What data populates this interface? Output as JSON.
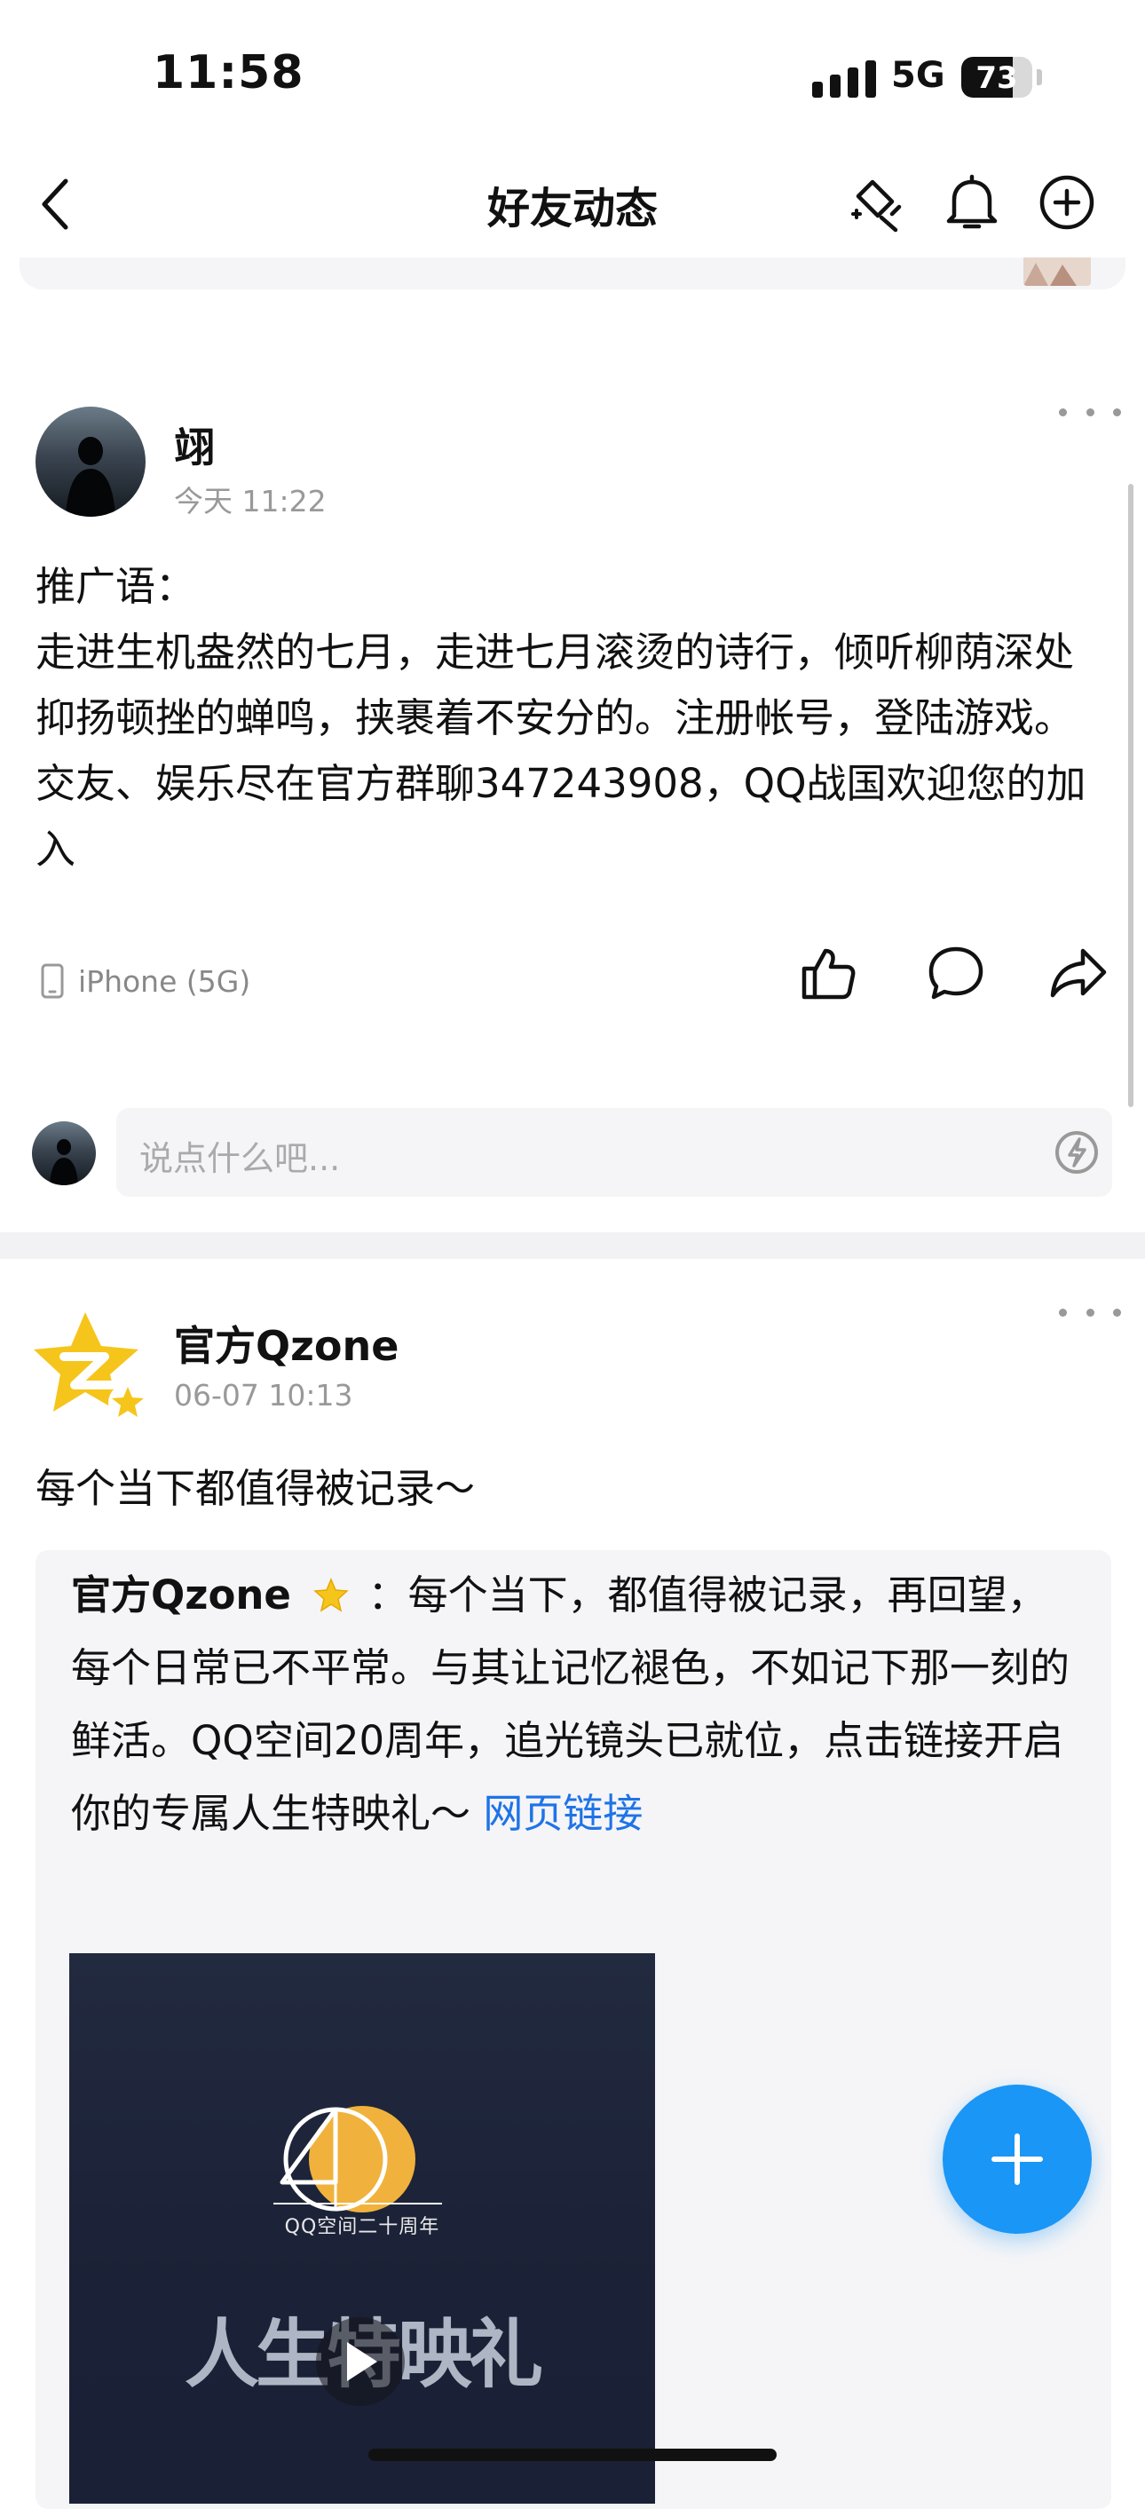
{
  "status_bar": {
    "time": "11:58",
    "network": "5G",
    "battery": "73",
    "battery_level": 0.73
  },
  "nav": {
    "title": "好友动态"
  },
  "posts": [
    {
      "author": "翊",
      "time": "今天 11:22",
      "text": "推广语：\n走进生机盎然的七月，走进七月滚烫的诗行，倾听柳荫深处抑扬顿挫的蝉鸣，挟裹着不安分的。注册帐号，登陆游戏。交友、娱乐尽在官方群聊347243908，QQ战国欢迎您的加入",
      "device": "iPhone (5G)"
    },
    {
      "author": "官方Qzone",
      "time": "06-07 10:13",
      "text": "每个当下都值得被记录～",
      "repost": {
        "author": "官方Qzone",
        "separator": "：",
        "text": "每个当下，都值得被记录，再回望，每个日常已不平常。与其让记忆褪色，不如记下那一刻的鲜活。QQ空间20周年，追光镜头已就位，点击链接开启你的专属人生特映礼～",
        "link": "网页链接",
        "video": {
          "badge_text": "QQ空间二十周年",
          "title": "人生特映礼"
        }
      }
    }
  ],
  "comment": {
    "placeholder": "说点什么吧..."
  },
  "icons": {
    "back": "back-icon",
    "edit": "edit-sparkle-icon",
    "bell": "bell-icon",
    "add": "add-circle-icon",
    "like": "thumbs-up-icon",
    "comment": "comment-bubble-icon",
    "share": "share-arrow-icon",
    "emoji": "emoji-lightning-icon",
    "phone": "phone-icon",
    "play": "play-icon",
    "verified": "star-badge-icon"
  },
  "colors": {
    "accent": "#1a96f6",
    "link": "#1e73e8",
    "gold": "#f5c518"
  }
}
